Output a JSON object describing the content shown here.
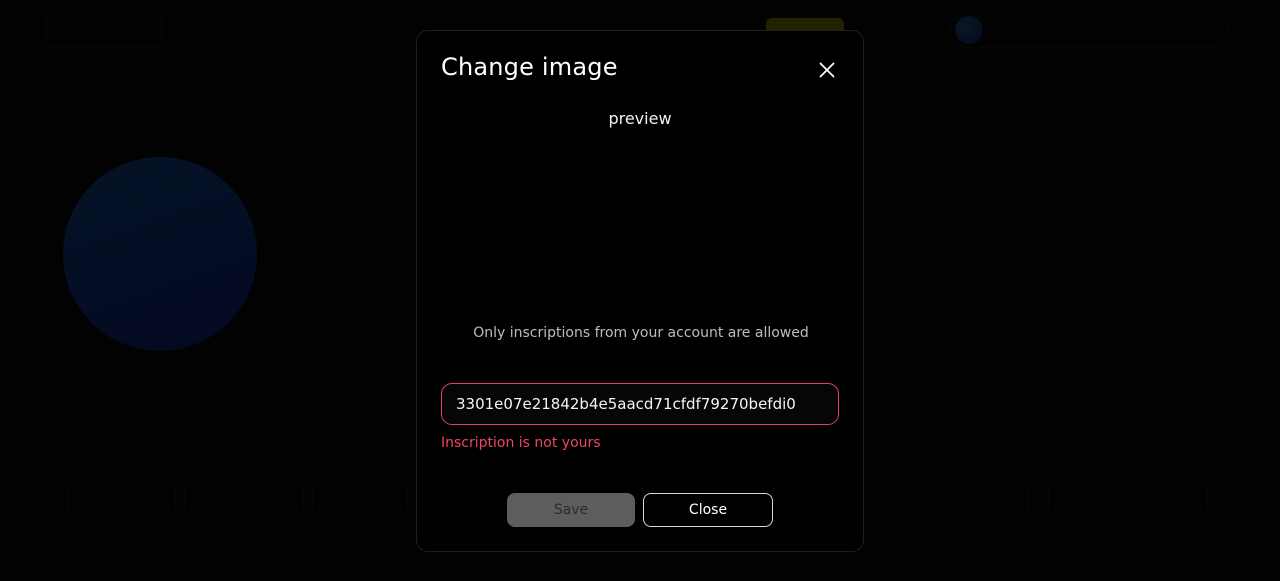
{
  "modal": {
    "title": "Change image",
    "preview_label": "preview",
    "hint": "Only inscriptions from your account are allowed",
    "input_value": "3301e07e21842b4e5aacd71cfdf79270befdi0",
    "error": "Inscription is not yours",
    "save_label": "Save",
    "close_label": "Close",
    "close_icon": "close-icon"
  },
  "colors": {
    "error": "#ef4565",
    "input_border": "#e0425f",
    "save_bg": "#5d5d5d",
    "modal_bg": "#000000"
  }
}
